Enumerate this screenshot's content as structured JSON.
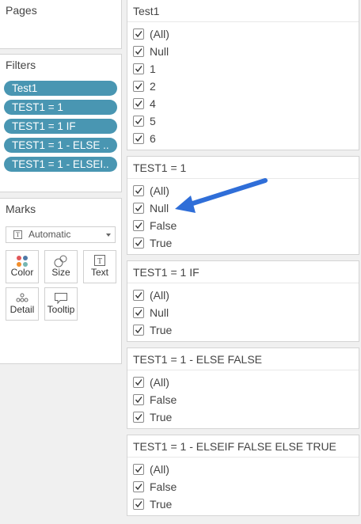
{
  "pages": {
    "title": "Pages"
  },
  "filters": {
    "title": "Filters",
    "pills": [
      "Test1",
      "TEST1 = 1",
      "TEST1 = 1  IF",
      "TEST1 = 1 - ELSE ..",
      "TEST1 = 1 - ELSEI.."
    ]
  },
  "marks": {
    "title": "Marks",
    "type_selected": "Automatic",
    "cards": [
      {
        "label": "Color",
        "icon": "color-icon"
      },
      {
        "label": "Size",
        "icon": "size-icon"
      },
      {
        "label": "Text",
        "icon": "text-icon"
      },
      {
        "label": "Detail",
        "icon": "detail-icon"
      },
      {
        "label": "Tooltip",
        "icon": "tooltip-icon"
      }
    ]
  },
  "filter_cards": [
    {
      "title": "Test1",
      "items": [
        "(All)",
        "Null",
        "1",
        "2",
        "4",
        "5",
        "6"
      ]
    },
    {
      "title": "TEST1 = 1",
      "items": [
        "(All)",
        "Null",
        "False",
        "True"
      ]
    },
    {
      "title": "TEST1 = 1  IF",
      "items": [
        "(All)",
        "Null",
        "True"
      ]
    },
    {
      "title": "TEST1 = 1 - ELSE FALSE",
      "items": [
        "(All)",
        "False",
        "True"
      ]
    },
    {
      "title": "TEST1 = 1 - ELSEIF FALSE ELSE TRUE",
      "items": [
        "(All)",
        "False",
        "True"
      ]
    }
  ],
  "annotation": {
    "color": "#2f6ed8",
    "icon": "arrow-icon"
  },
  "colors": {
    "pill": "#4996b2"
  }
}
